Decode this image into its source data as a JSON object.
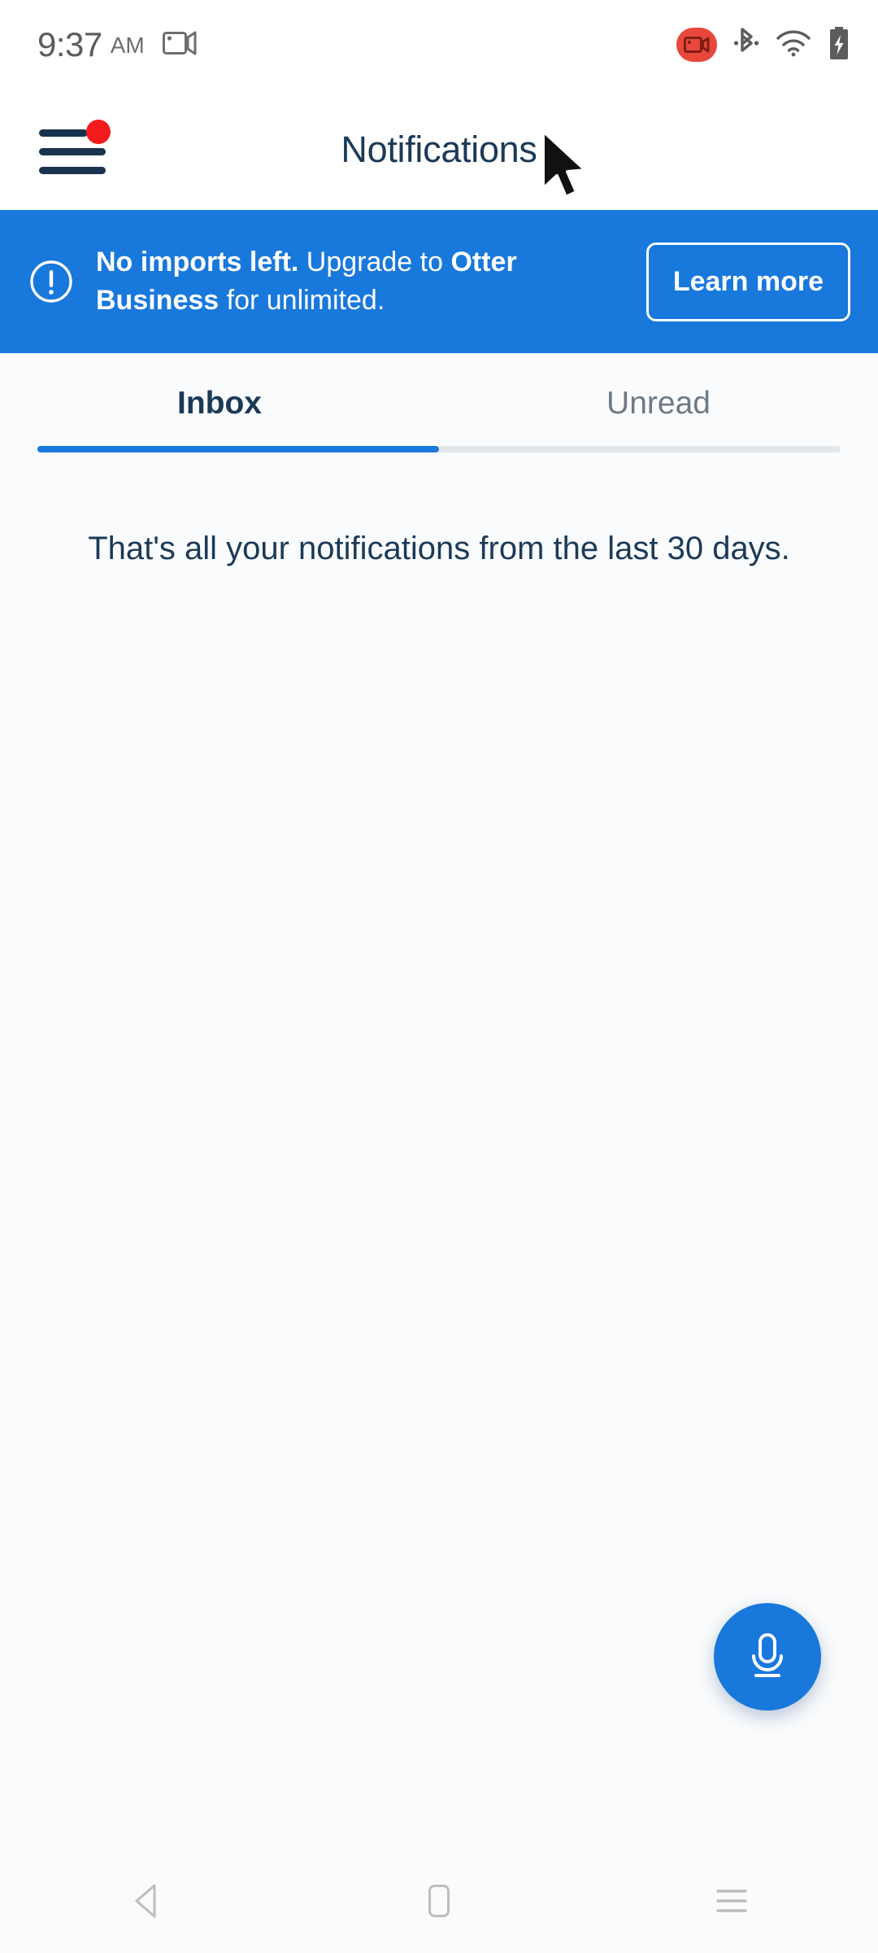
{
  "status_bar": {
    "time": "9:37",
    "ampm": "AM",
    "icons": [
      "screencast-icon",
      "screen-record-badge-icon",
      "bluetooth-icon",
      "wifi-icon",
      "battery-charging-icon"
    ]
  },
  "header": {
    "menu_icon": "hamburger-menu-icon",
    "menu_badge": "notification-dot",
    "title": "Notifications"
  },
  "promo_banner": {
    "icon": "alert-circle-icon",
    "text_bold_1": "No imports left.",
    "text_normal_1": " Upgrade to ",
    "text_bold_2": "Otter Business",
    "text_normal_2": " for unlimited.",
    "button_label": "Learn more",
    "background_color": "#1878DC",
    "text_color": "#FFFFFF"
  },
  "tabs": {
    "items": [
      {
        "label": "Inbox",
        "active": true
      },
      {
        "label": "Unread",
        "active": false
      }
    ],
    "active_color": "#1B3A57",
    "inactive_color": "#6D7A86",
    "indicator_color": "#1878DC"
  },
  "content": {
    "empty_message": "That's all your notifications from the last 30 days."
  },
  "fab": {
    "icon": "microphone-icon",
    "color": "#1878DC"
  },
  "nav_bar": {
    "back": "back-triangle-icon",
    "home": "home-square-icon",
    "recents": "recents-lines-icon"
  },
  "cursor": {
    "icon": "mouse-pointer-icon"
  }
}
